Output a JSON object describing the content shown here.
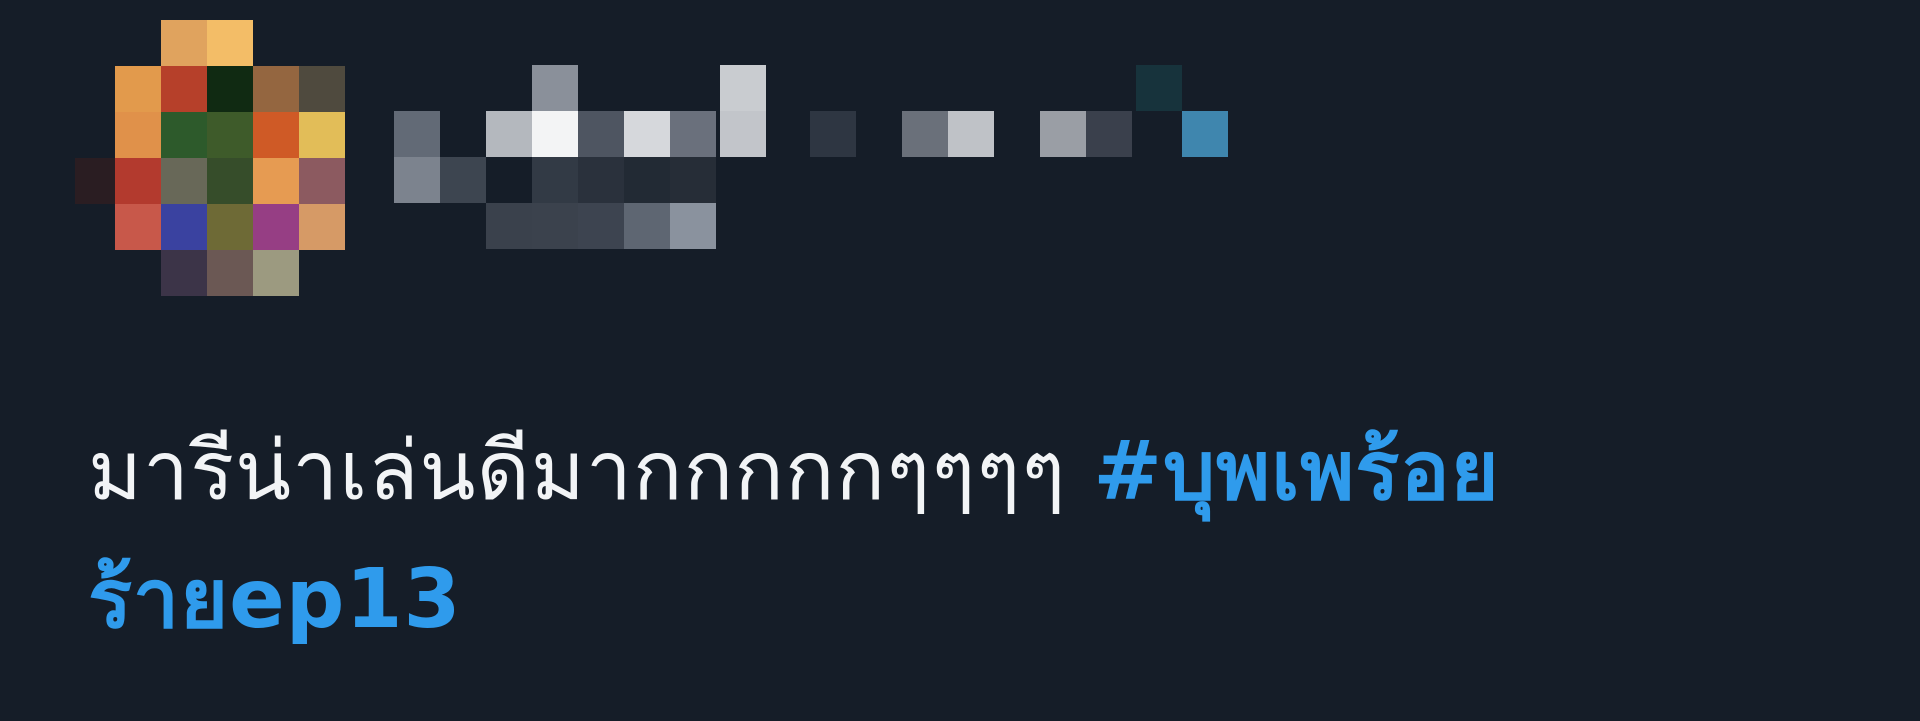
{
  "tweet": {
    "text": "มารีน่าเล่นดีมากกกกกๆๆๆๆ ",
    "hashtag": "#บุพเพร้อยร้ายep13"
  },
  "colors": {
    "background": "#151d28",
    "text": "#f2f4f6",
    "hashtag": "#2f9bec"
  }
}
